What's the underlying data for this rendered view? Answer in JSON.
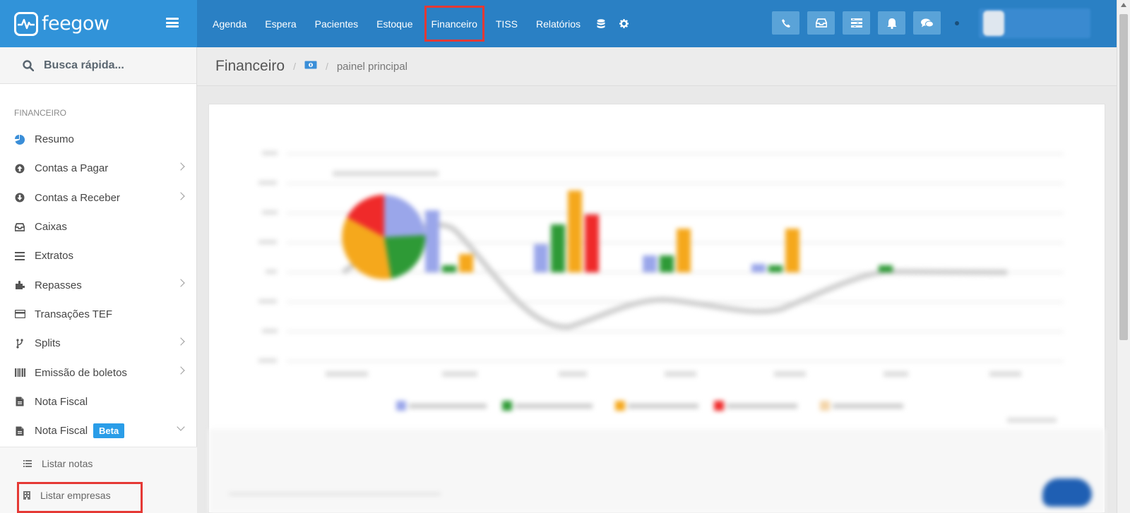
{
  "brand": {
    "name": "feegow"
  },
  "nav": {
    "items": [
      {
        "label": "Agenda"
      },
      {
        "label": "Espera"
      },
      {
        "label": "Pacientes"
      },
      {
        "label": "Estoque"
      },
      {
        "label": "Financeiro",
        "highlighted": true
      },
      {
        "label": "TISS"
      },
      {
        "label": "Relatórios"
      }
    ],
    "extra_icons": [
      "database-icon",
      "gear-icon"
    ]
  },
  "actions": [
    "phone-icon",
    "inbox-icon",
    "list-icon",
    "bell-icon",
    "chat-icon"
  ],
  "search": {
    "placeholder": "Busca rápida..."
  },
  "sidebar": {
    "section": "FINANCEIRO",
    "items": [
      {
        "label": "Resumo",
        "icon": "pie-chart-icon"
      },
      {
        "label": "Contas a Pagar",
        "icon": "arrow-up-circle-icon",
        "has_submenu": true
      },
      {
        "label": "Contas a Receber",
        "icon": "arrow-down-circle-icon",
        "has_submenu": true
      },
      {
        "label": "Caixas",
        "icon": "inbox-icon"
      },
      {
        "label": "Extratos",
        "icon": "lines-icon"
      },
      {
        "label": "Repasses",
        "icon": "puzzle-icon",
        "has_submenu": true
      },
      {
        "label": "Transações TEF",
        "icon": "credit-card-icon"
      },
      {
        "label": "Splits",
        "icon": "fork-icon",
        "has_submenu": true
      },
      {
        "label": "Emissão de boletos",
        "icon": "barcode-icon",
        "has_submenu": true
      },
      {
        "label": "Nota Fiscal",
        "icon": "file-icon"
      },
      {
        "label": "Nota Fiscal",
        "icon": "file-icon",
        "badge": "Beta",
        "expanded": true
      }
    ],
    "submenu": [
      {
        "label": "Listar notas",
        "icon": "list-icon"
      },
      {
        "label": "Listar empresas",
        "icon": "building-icon",
        "highlighted": true
      }
    ]
  },
  "breadcrumb": {
    "title": "Financeiro",
    "icon": "money-icon",
    "page": "painel principal"
  },
  "colors": {
    "topbar": "#2a80c4",
    "brand_bg": "#3193d9",
    "highlight_border": "#e53935",
    "badge": "#2a9de8"
  }
}
